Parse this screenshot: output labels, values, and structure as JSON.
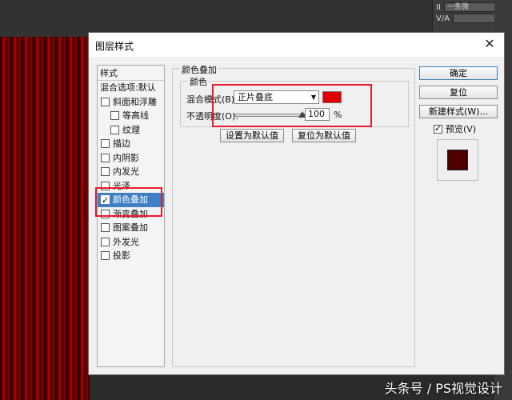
{
  "workspace": {
    "panel_labels": [
      "V/A",
      "II"
    ],
    "panel_field": "一条微"
  },
  "dialog": {
    "title": "图层样式",
    "close": "✕"
  },
  "style_list": {
    "header": "样式",
    "blend_options": "混合选项:默认",
    "items": [
      {
        "label": "斜面和浮雕",
        "checked": false
      },
      {
        "label": "等高线",
        "checked": false
      },
      {
        "label": "纹理",
        "checked": false
      },
      {
        "label": "描边",
        "checked": false
      },
      {
        "label": "内阴影",
        "checked": false
      },
      {
        "label": "内发光",
        "checked": false
      },
      {
        "label": "光泽",
        "checked": false
      },
      {
        "label": "颜色叠加",
        "checked": true
      },
      {
        "label": "渐变叠加",
        "checked": false
      },
      {
        "label": "图案叠加",
        "checked": false
      },
      {
        "label": "外发光",
        "checked": false
      },
      {
        "label": "投影",
        "checked": false
      }
    ]
  },
  "color_overlay": {
    "group_title": "颜色叠加",
    "sub_title": "颜色",
    "blend_mode_label": "混合模式(B):",
    "blend_mode_value": "正片叠底",
    "overlay_color": "#e00000",
    "opacity_label": "不透明度(O):",
    "opacity_value": "100",
    "opacity_unit": "%",
    "opacity_fraction": 1.0,
    "make_default": "设置为默认值",
    "reset_default": "复位为默认值"
  },
  "buttons": {
    "ok": "确定",
    "reset": "复位",
    "new_style": "新建样式(W)...",
    "preview": "预览(V)",
    "preview_checked": true
  },
  "preview_color": "#500000",
  "watermark": "头条号 / PS视觉设计"
}
